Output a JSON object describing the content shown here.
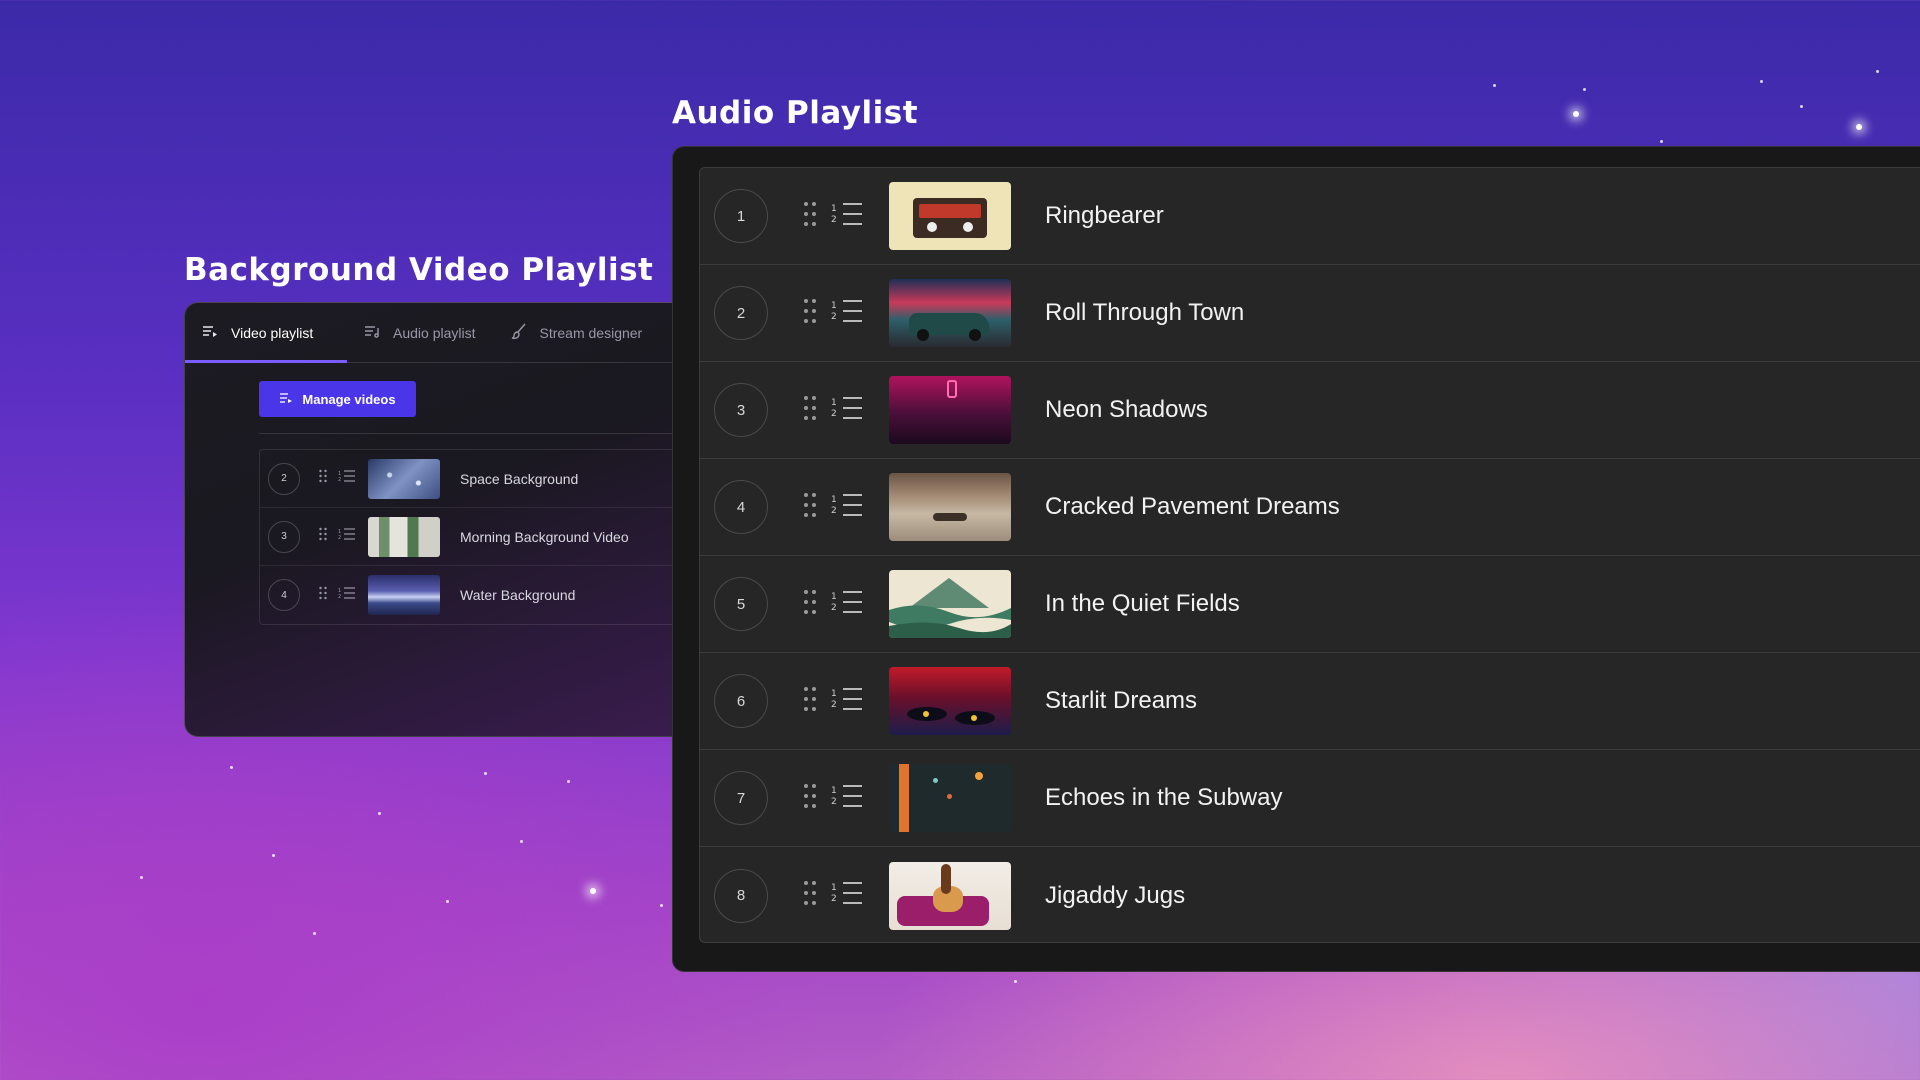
{
  "titles": {
    "background_video": "Background Video Playlist",
    "audio": "Audio Playlist"
  },
  "video_panel": {
    "tabs": [
      {
        "label": "Video playlist",
        "active": true,
        "icon": "video-playlist-icon"
      },
      {
        "label": "Audio playlist",
        "active": false,
        "icon": "audio-playlist-icon"
      },
      {
        "label": "Stream designer",
        "active": false,
        "icon": "brush-icon"
      }
    ],
    "manage_button": "Manage videos",
    "items": [
      {
        "number": "2",
        "title": "Space Background"
      },
      {
        "number": "3",
        "title": "Morning Background Video"
      },
      {
        "number": "4",
        "title": "Water Background"
      }
    ]
  },
  "audio_panel": {
    "items": [
      {
        "number": "1",
        "title": "Ringbearer"
      },
      {
        "number": "2",
        "title": "Roll Through Town"
      },
      {
        "number": "3",
        "title": "Neon Shadows"
      },
      {
        "number": "4",
        "title": "Cracked Pavement Dreams"
      },
      {
        "number": "5",
        "title": "In the Quiet Fields"
      },
      {
        "number": "6",
        "title": "Starlit Dreams"
      },
      {
        "number": "7",
        "title": "Echoes in the Subway"
      },
      {
        "number": "8",
        "title": "Jigaddy Jugs"
      }
    ]
  },
  "colors": {
    "accent": "#4a35e8",
    "tab_indicator": "#7a5cff",
    "panel_bg": "#181818",
    "row_bg": "#262626"
  }
}
